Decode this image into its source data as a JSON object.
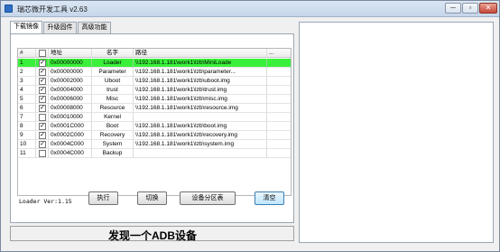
{
  "window": {
    "title": "瑞芯微开发工具 v2.63",
    "min_label": "─",
    "max_label": "▫",
    "close_label": "✕"
  },
  "tabs": [
    {
      "label": "下载镜像",
      "active": true
    },
    {
      "label": "升级固件",
      "active": false
    },
    {
      "label": "高级功能",
      "active": false
    }
  ],
  "table": {
    "headers": [
      "#",
      "☐",
      "地址",
      "名字",
      "路径",
      "..."
    ],
    "rows": [
      {
        "num": "1",
        "checked": true,
        "address": "0x00000000",
        "name": "Loader",
        "path": "\\\\192.168.1.181\\work1\\lzb\\MiniLoade",
        "extra": "",
        "selected": true
      },
      {
        "num": "2",
        "checked": true,
        "address": "0x00000000",
        "name": "Parameter",
        "path": "\\\\192.168.1.181\\work1\\lzb\\parameter...",
        "extra": "",
        "selected": false
      },
      {
        "num": "3",
        "checked": true,
        "address": "0x00002000",
        "name": "Uboot",
        "path": "\\\\192.168.1.181\\work1\\lzb\\uboot.img",
        "extra": "",
        "selected": false
      },
      {
        "num": "4",
        "checked": true,
        "address": "0x00004000",
        "name": "trust",
        "path": "\\\\192.168.1.181\\work1\\lzb\\trust.img",
        "extra": "",
        "selected": false
      },
      {
        "num": "5",
        "checked": true,
        "address": "0x00006000",
        "name": "Misc",
        "path": "\\\\192.168.1.181\\work1\\lzb\\misc.img",
        "extra": "",
        "selected": false
      },
      {
        "num": "6",
        "checked": true,
        "address": "0x00008000",
        "name": "Resource",
        "path": "\\\\192.168.1.181\\work1\\lzb\\resource.img",
        "extra": "",
        "selected": false
      },
      {
        "num": "7",
        "checked": false,
        "address": "0x00010000",
        "name": "Kernel",
        "path": "",
        "extra": "",
        "selected": false
      },
      {
        "num": "8",
        "checked": true,
        "address": "0x0001C000",
        "name": "Boot",
        "path": "\\\\192.168.1.181\\work1\\lzb\\boot.img",
        "extra": "",
        "selected": false
      },
      {
        "num": "9",
        "checked": true,
        "address": "0x0002C000",
        "name": "Recovery",
        "path": "\\\\192.168.1.181\\work1\\lzb\\recovery.img",
        "extra": "",
        "selected": false
      },
      {
        "num": "10",
        "checked": true,
        "address": "0x0004C000",
        "name": "System",
        "path": "\\\\192.168.1.181\\work1\\lzb\\system.img",
        "extra": "",
        "selected": false
      },
      {
        "num": "11",
        "checked": false,
        "address": "0x0004C000",
        "name": "Backup",
        "path": "",
        "extra": "",
        "selected": false
      }
    ]
  },
  "bottom": {
    "loader_version": "Loader Ver:1.15",
    "run_label": "执行",
    "switch_label": "切换",
    "partitions_label": "设备分区表",
    "clear_label": "清空"
  },
  "status": {
    "message": "发现一个ADB设备"
  },
  "colors": {
    "selected_row": "#3af03a",
    "title_bar": "#c6d6ea",
    "close_button": "#c6483a"
  }
}
